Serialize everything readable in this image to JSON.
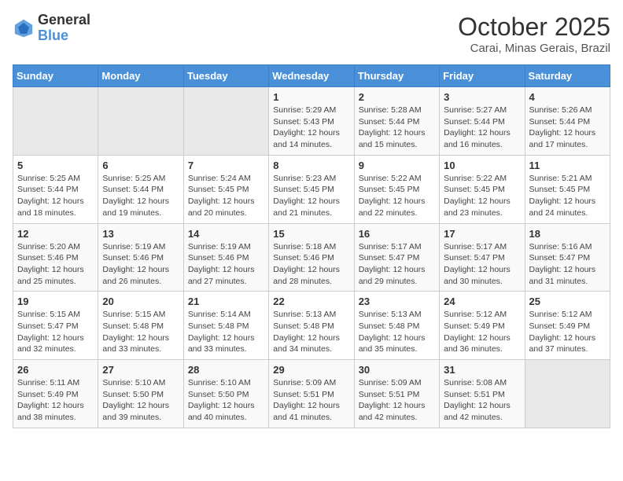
{
  "header": {
    "logo_general": "General",
    "logo_blue": "Blue",
    "month": "October 2025",
    "location": "Carai, Minas Gerais, Brazil"
  },
  "days_of_week": [
    "Sunday",
    "Monday",
    "Tuesday",
    "Wednesday",
    "Thursday",
    "Friday",
    "Saturday"
  ],
  "weeks": [
    [
      {
        "day": "",
        "info": ""
      },
      {
        "day": "",
        "info": ""
      },
      {
        "day": "",
        "info": ""
      },
      {
        "day": "1",
        "sunrise": "Sunrise: 5:29 AM",
        "sunset": "Sunset: 5:43 PM",
        "daylight": "Daylight: 12 hours and 14 minutes."
      },
      {
        "day": "2",
        "sunrise": "Sunrise: 5:28 AM",
        "sunset": "Sunset: 5:44 PM",
        "daylight": "Daylight: 12 hours and 15 minutes."
      },
      {
        "day": "3",
        "sunrise": "Sunrise: 5:27 AM",
        "sunset": "Sunset: 5:44 PM",
        "daylight": "Daylight: 12 hours and 16 minutes."
      },
      {
        "day": "4",
        "sunrise": "Sunrise: 5:26 AM",
        "sunset": "Sunset: 5:44 PM",
        "daylight": "Daylight: 12 hours and 17 minutes."
      }
    ],
    [
      {
        "day": "5",
        "sunrise": "Sunrise: 5:25 AM",
        "sunset": "Sunset: 5:44 PM",
        "daylight": "Daylight: 12 hours and 18 minutes."
      },
      {
        "day": "6",
        "sunrise": "Sunrise: 5:25 AM",
        "sunset": "Sunset: 5:44 PM",
        "daylight": "Daylight: 12 hours and 19 minutes."
      },
      {
        "day": "7",
        "sunrise": "Sunrise: 5:24 AM",
        "sunset": "Sunset: 5:45 PM",
        "daylight": "Daylight: 12 hours and 20 minutes."
      },
      {
        "day": "8",
        "sunrise": "Sunrise: 5:23 AM",
        "sunset": "Sunset: 5:45 PM",
        "daylight": "Daylight: 12 hours and 21 minutes."
      },
      {
        "day": "9",
        "sunrise": "Sunrise: 5:22 AM",
        "sunset": "Sunset: 5:45 PM",
        "daylight": "Daylight: 12 hours and 22 minutes."
      },
      {
        "day": "10",
        "sunrise": "Sunrise: 5:22 AM",
        "sunset": "Sunset: 5:45 PM",
        "daylight": "Daylight: 12 hours and 23 minutes."
      },
      {
        "day": "11",
        "sunrise": "Sunrise: 5:21 AM",
        "sunset": "Sunset: 5:45 PM",
        "daylight": "Daylight: 12 hours and 24 minutes."
      }
    ],
    [
      {
        "day": "12",
        "sunrise": "Sunrise: 5:20 AM",
        "sunset": "Sunset: 5:46 PM",
        "daylight": "Daylight: 12 hours and 25 minutes."
      },
      {
        "day": "13",
        "sunrise": "Sunrise: 5:19 AM",
        "sunset": "Sunset: 5:46 PM",
        "daylight": "Daylight: 12 hours and 26 minutes."
      },
      {
        "day": "14",
        "sunrise": "Sunrise: 5:19 AM",
        "sunset": "Sunset: 5:46 PM",
        "daylight": "Daylight: 12 hours and 27 minutes."
      },
      {
        "day": "15",
        "sunrise": "Sunrise: 5:18 AM",
        "sunset": "Sunset: 5:46 PM",
        "daylight": "Daylight: 12 hours and 28 minutes."
      },
      {
        "day": "16",
        "sunrise": "Sunrise: 5:17 AM",
        "sunset": "Sunset: 5:47 PM",
        "daylight": "Daylight: 12 hours and 29 minutes."
      },
      {
        "day": "17",
        "sunrise": "Sunrise: 5:17 AM",
        "sunset": "Sunset: 5:47 PM",
        "daylight": "Daylight: 12 hours and 30 minutes."
      },
      {
        "day": "18",
        "sunrise": "Sunrise: 5:16 AM",
        "sunset": "Sunset: 5:47 PM",
        "daylight": "Daylight: 12 hours and 31 minutes."
      }
    ],
    [
      {
        "day": "19",
        "sunrise": "Sunrise: 5:15 AM",
        "sunset": "Sunset: 5:47 PM",
        "daylight": "Daylight: 12 hours and 32 minutes."
      },
      {
        "day": "20",
        "sunrise": "Sunrise: 5:15 AM",
        "sunset": "Sunset: 5:48 PM",
        "daylight": "Daylight: 12 hours and 33 minutes."
      },
      {
        "day": "21",
        "sunrise": "Sunrise: 5:14 AM",
        "sunset": "Sunset: 5:48 PM",
        "daylight": "Daylight: 12 hours and 33 minutes."
      },
      {
        "day": "22",
        "sunrise": "Sunrise: 5:13 AM",
        "sunset": "Sunset: 5:48 PM",
        "daylight": "Daylight: 12 hours and 34 minutes."
      },
      {
        "day": "23",
        "sunrise": "Sunrise: 5:13 AM",
        "sunset": "Sunset: 5:48 PM",
        "daylight": "Daylight: 12 hours and 35 minutes."
      },
      {
        "day": "24",
        "sunrise": "Sunrise: 5:12 AM",
        "sunset": "Sunset: 5:49 PM",
        "daylight": "Daylight: 12 hours and 36 minutes."
      },
      {
        "day": "25",
        "sunrise": "Sunrise: 5:12 AM",
        "sunset": "Sunset: 5:49 PM",
        "daylight": "Daylight: 12 hours and 37 minutes."
      }
    ],
    [
      {
        "day": "26",
        "sunrise": "Sunrise: 5:11 AM",
        "sunset": "Sunset: 5:49 PM",
        "daylight": "Daylight: 12 hours and 38 minutes."
      },
      {
        "day": "27",
        "sunrise": "Sunrise: 5:10 AM",
        "sunset": "Sunset: 5:50 PM",
        "daylight": "Daylight: 12 hours and 39 minutes."
      },
      {
        "day": "28",
        "sunrise": "Sunrise: 5:10 AM",
        "sunset": "Sunset: 5:50 PM",
        "daylight": "Daylight: 12 hours and 40 minutes."
      },
      {
        "day": "29",
        "sunrise": "Sunrise: 5:09 AM",
        "sunset": "Sunset: 5:51 PM",
        "daylight": "Daylight: 12 hours and 41 minutes."
      },
      {
        "day": "30",
        "sunrise": "Sunrise: 5:09 AM",
        "sunset": "Sunset: 5:51 PM",
        "daylight": "Daylight: 12 hours and 42 minutes."
      },
      {
        "day": "31",
        "sunrise": "Sunrise: 5:08 AM",
        "sunset": "Sunset: 5:51 PM",
        "daylight": "Daylight: 12 hours and 42 minutes."
      },
      {
        "day": "",
        "info": ""
      }
    ]
  ]
}
